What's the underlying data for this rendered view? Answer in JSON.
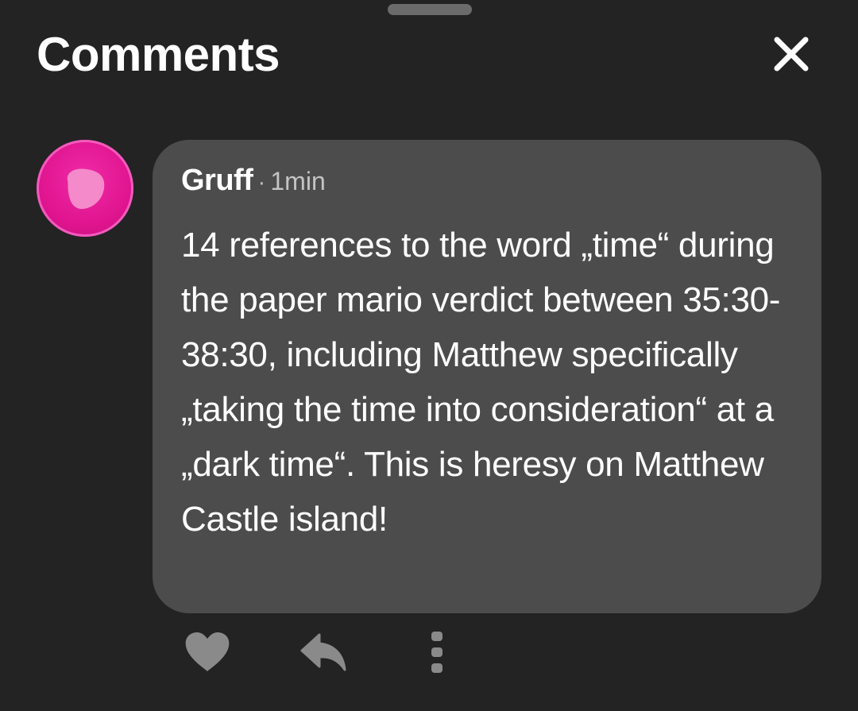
{
  "header": {
    "title": "Comments"
  },
  "comment": {
    "author": "Gruff",
    "separator": "·",
    "time_ago": "1min",
    "text": "14 references to the word „time“ during the paper mario verdict between 35:30-38:30, including Matthew specifically „taking the time into consideration“ at a „dark time“. This is heresy on Matthew Castle island!"
  },
  "icons": {
    "close": "close-icon",
    "like": "heart-icon",
    "reply": "reply-icon",
    "more": "more-vertical-icon",
    "avatar": "avatar-blob-icon"
  },
  "colors": {
    "background": "#232323",
    "bubble": "#4c4c4c",
    "avatar": "#e0158f",
    "action_icons": "#8a8a8a"
  }
}
